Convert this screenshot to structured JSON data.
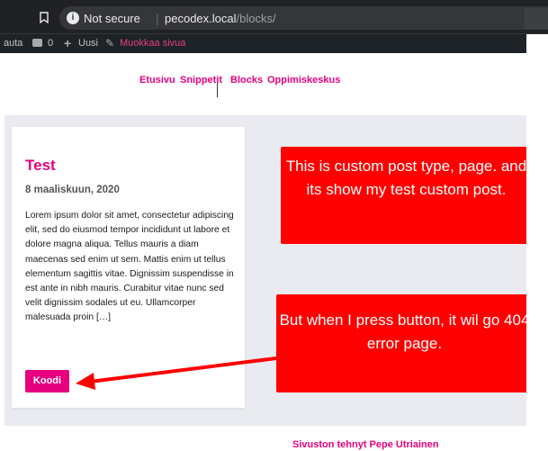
{
  "browser": {
    "security_label": "Not secure",
    "url_host": "pecodex.local",
    "url_path": "/blocks/"
  },
  "admin_bar": {
    "customize_label": "auta",
    "comments_count": "0",
    "new_label": "Uusi",
    "edit_label": "Muokkaa sivua"
  },
  "nav": {
    "items": [
      "Etusivu",
      "Snippetit",
      "Blocks",
      "Oppimiskeskus"
    ]
  },
  "post": {
    "title": "Test",
    "date": "8 maaliskuun, 2020",
    "excerpt": "Lorem ipsum dolor sit amet, consectetur adipiscing elit, sed do eiusmod tempor incididunt ut labore et dolore magna aliqua. Tellus mauris a diam maecenas sed enim ut sem. Mattis enim ut tellus elementum sagittis vitae. Dignissim suspendisse in est ante in nibh mauris. Curabitur vitae nunc sed velit dignissim sodales ut eu. Ullamcorper malesuada proin […]",
    "button_label": "Koodi"
  },
  "annotations": {
    "note_1": "This is custom post type, page. and its show my test custom post.",
    "note_2": "But when I press button, it wil go 404 error page."
  },
  "footer": {
    "credit": "Sivuston tehnyt Pepe Utriainen"
  },
  "colors": {
    "accent": "#e6007e",
    "annotation": "#ff0000",
    "admin_bar": "#1d2327",
    "browser_chrome": "#202124"
  }
}
